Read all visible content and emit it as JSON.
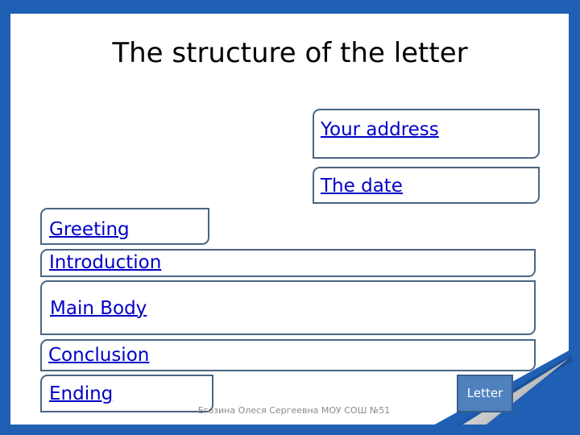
{
  "slide": {
    "title": "The structure of the letter",
    "boxes": {
      "your_address": "Your address",
      "the_date": "The date",
      "greeting": "Greeting",
      "introduction": "Introduction",
      "main_body": "Main Body",
      "conclusion": "Conclusion",
      "ending": "Ending"
    },
    "letter_button": "Letter",
    "footer": "Егозина Олеся Сергеевна МОУ СОШ №51"
  },
  "colors": {
    "background": "#1f5fb4",
    "link": "#0000c8",
    "box_border": "#4a6583",
    "button_fill": "#4f81bd",
    "button_border": "#385d8a"
  }
}
